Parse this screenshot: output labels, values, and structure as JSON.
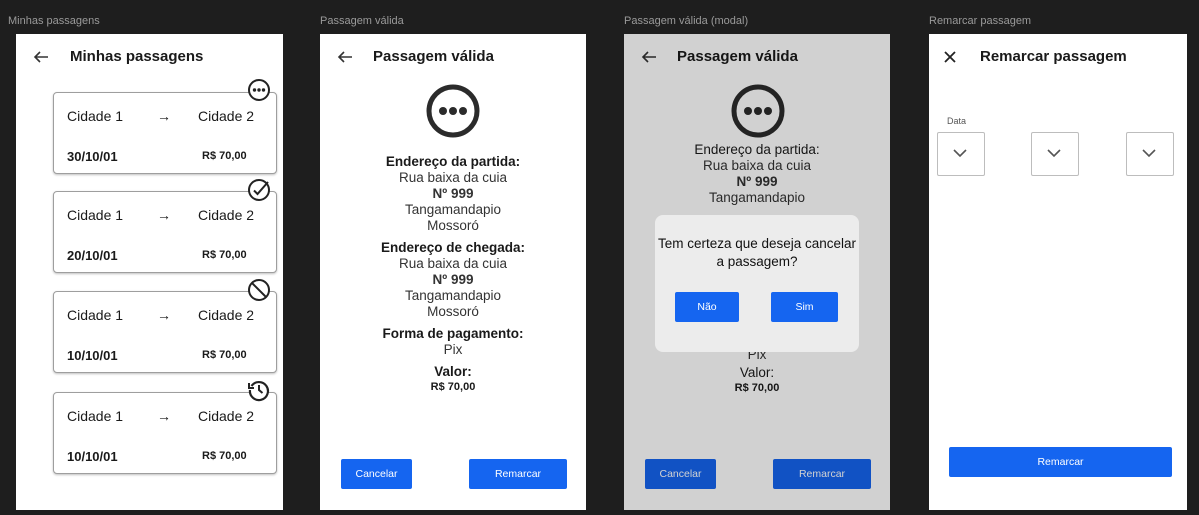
{
  "frames": {
    "list_label": "Minhas passagens",
    "valid_label": "Passagem válida",
    "modal_label": "Passagem válida (modal)",
    "reschedule_label": "Remarcar passagem"
  },
  "list_screen": {
    "title": "Minhas passagens",
    "tickets": [
      {
        "origin": "Cidade 1",
        "arrow": "→",
        "destination": "Cidade 2",
        "date": "30/10/01",
        "price": "R$ 70,00",
        "status_icon": "more-options-icon"
      },
      {
        "origin": "Cidade 1",
        "arrow": "→",
        "destination": "Cidade 2",
        "date": "20/10/01",
        "price": "R$ 70,00",
        "status_icon": "check-circle-icon"
      },
      {
        "origin": "Cidade 1",
        "arrow": "→",
        "destination": "Cidade 2",
        "date": "10/10/01",
        "price": "R$ 70,00",
        "status_icon": "blocked-icon"
      },
      {
        "origin": "Cidade 1",
        "arrow": "→",
        "destination": "Cidade 2",
        "date": "10/10/01",
        "price": "R$ 70,00",
        "status_icon": "history-icon"
      }
    ]
  },
  "details": {
    "title": "Passagem válida",
    "departure_heading": "Endereço da partida:",
    "departure_street": "Rua baixa da cuia",
    "departure_number": "Nº 999",
    "departure_district": "Tangamandapio",
    "departure_city": "Mossoró",
    "arrival_heading": "Endereço de chegada:",
    "arrival_street": "Rua baixa da cuia",
    "arrival_number": "Nº 999",
    "arrival_district": "Tangamandapio",
    "arrival_city": "Mossoró",
    "payment_heading": "Forma de pagamento:",
    "payment_method": "Pix",
    "value_heading": "Valor:",
    "value": "R$ 70,00",
    "cancel_label": "Cancelar",
    "reschedule_label": "Remarcar"
  },
  "modal": {
    "title": "Passagem válida",
    "departure_heading": "Endereço da partida:",
    "departure_street": "Rua baixa da cuia",
    "departure_number": "Nº 999",
    "departure_district": "Tangamandapio",
    "payment_method": "Pix",
    "value_heading": "Valor:",
    "value": "R$ 70,00",
    "question": "Tem certeza que deseja cancelar a passagem?",
    "no_label": "Não",
    "yes_label": "Sim",
    "cancel_label": "Cancelar",
    "reschedule_label": "Remarcar"
  },
  "reschedule": {
    "title": "Remarcar passagem",
    "date_label": "Data",
    "submit_label": "Remarcar"
  },
  "colors": {
    "primary": "#1565f0",
    "background": "#1e1e1e"
  }
}
